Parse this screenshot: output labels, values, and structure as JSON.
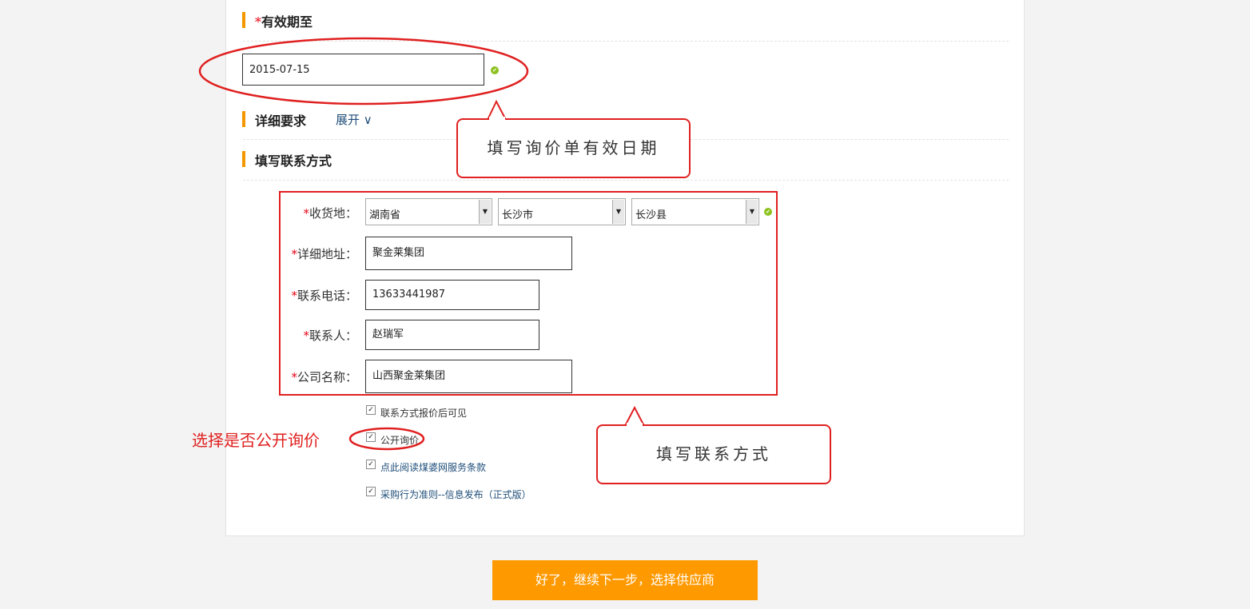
{
  "sections": {
    "validity": {
      "required_mark": "*",
      "title": "有效期至"
    },
    "details": {
      "title": "详细要求",
      "expand_label": "展开 ∨"
    },
    "contact": {
      "title": "填写联系方式"
    }
  },
  "validity_date": {
    "value": "2015-07-15"
  },
  "form": {
    "required_mark": "*",
    "ship_label": "收货地：",
    "province": "湖南省",
    "city": "长沙市",
    "county": "长沙县",
    "address_label": "详细地址：",
    "address_value": "聚金莱集团",
    "phone_label": "联系电话：",
    "phone_value": "13633441987",
    "person_label": "联系人：",
    "person_value": "赵瑞军",
    "company_label": "公司名称：",
    "company_value": "山西聚金莱集团"
  },
  "checkboxes": [
    {
      "label": "联系方式报价后可见",
      "checked": true
    },
    {
      "label": "公开询价",
      "checked": true
    },
    {
      "label": "点此阅读煤婆网服务条款",
      "checked": true
    },
    {
      "label": "采购行为准则--信息发布（正式版）",
      "checked": true
    }
  ],
  "callouts": {
    "date": "填写询价单有效日期",
    "contact": "填写联系方式",
    "public": "选择是否公开询价"
  },
  "submit_label": "好了，继续下一步，选择供应商",
  "colors": {
    "accent": "#ff9900",
    "annotation": "#e02020",
    "ok": "#8dc21f",
    "link": "#1f4e79"
  }
}
